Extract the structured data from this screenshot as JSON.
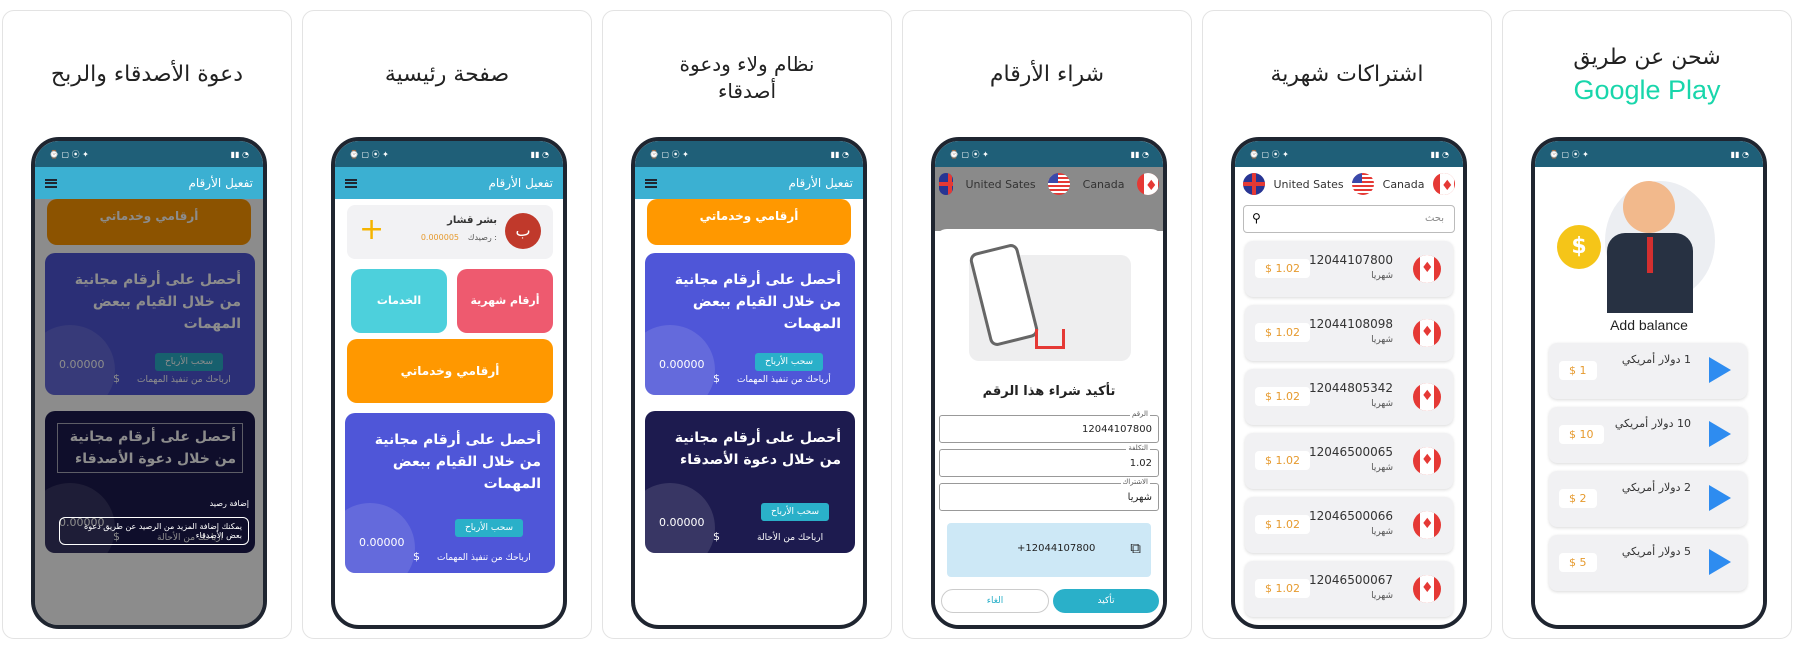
{
  "captions": {
    "p1": "شحن عن طريق",
    "p1_brand": "Google Play",
    "p2": "اشتراكات شهرية",
    "p3": "شراء الأرقام",
    "p4": "نظام ولاء ودعوة أصدقاء",
    "p5": "صفحة رئيسية",
    "p6": "دعوة الأصدقاء والربح"
  },
  "colors": {
    "brand_teal": "#19d6ab",
    "appbar": "#3bb0d2",
    "status": "#1f5f78",
    "orange": "#ff9800",
    "purple": "#4f56d8",
    "navy": "#1d1b4f"
  },
  "appbar_title": "تفعيل الأرقام",
  "recharge": {
    "heading": "Add balance",
    "items": [
      {
        "label": "1 دولار أمريكي",
        "price": "$ 1"
      },
      {
        "label": "10 دولار أمريكي",
        "price": "$ 10"
      },
      {
        "label": "2 دولار أمريكي",
        "price": "$ 2"
      },
      {
        "label": "5 دولار أمريكي",
        "price": "$ 5"
      }
    ]
  },
  "subscriptions": {
    "countries": [
      "United Sates",
      "Canada"
    ],
    "search_placeholder": "بحث",
    "rows": [
      {
        "number": "12044107800",
        "period": "شهريا",
        "price": "$ 1.02"
      },
      {
        "number": "12044108098",
        "period": "شهريا",
        "price": "$ 1.02"
      },
      {
        "number": "12044805342",
        "period": "شهريا",
        "price": "$ 1.02"
      },
      {
        "number": "12046500065",
        "period": "شهريا",
        "price": "$ 1.02"
      },
      {
        "number": "12046500066",
        "period": "شهريا",
        "price": "$ 1.02"
      },
      {
        "number": "12046500067",
        "period": "شهريا",
        "price": "$ 1.02"
      }
    ]
  },
  "purchase": {
    "countries": [
      "United Sates",
      "Canada"
    ],
    "confirm_title": "تأكيد شراء هذا الرقم",
    "field_number_label": "الرقم",
    "field_number_value": "12044107800",
    "field_cost_label": "التكلفة",
    "field_cost_value": "1.02",
    "field_sub_label": "الاشتراك",
    "field_sub_value": "شهريا",
    "copy_value": "+12044107800",
    "cancel": "الغاء",
    "confirm": "تأكيد"
  },
  "loyalty": {
    "orange_tile": "أرقامي وخدماتي",
    "tasks_title": "أحصل على أرقام مجانية من خلال القيام ببعض المهمات",
    "withdraw": "سحب الأرباح",
    "tasks_earnings": "أرباحك من تنفيذ المهمات",
    "amount": "0.00000",
    "currency": "$",
    "invite_title": "أحصل على أرقام مجانية من خلال دعوة الأصدقاء",
    "invite_earnings": "ارباحك من الأحالة"
  },
  "home": {
    "user_name": "بشر قشار",
    "balance_label": "رصيدك :",
    "balance_value": "0.000005",
    "avatar_letter": "ب",
    "monthly_numbers": "أرقام شهرية",
    "services": "الخدمات",
    "my_numbers": "أرقامي وخدماتي",
    "tasks_title": "أحصل على أرقام مجانية من خلال القيام ببعض المهمات",
    "withdraw": "سحب الأرباح",
    "amount": "0.00000",
    "currency": "$",
    "tasks_earnings": "ارباحك من تنفيذ المهمات"
  },
  "invite": {
    "orange_tile": "أرقامي وخدماتي",
    "tasks_title": "أحصل على أرقام مجانية من خلال القيام ببعض المهمات",
    "withdraw": "سحب الأرباح",
    "amount": "0.00000",
    "currency": "$",
    "tasks_earnings": "ارباحك من تنفيذ المهمات",
    "invite_title": "أحصل على أرقام مجانية من خلال دعوة الأصدقاء",
    "add_balance": "إضافة رصيد",
    "tooltip": "يمكنك إضافة المزيد من الرصيد عن طريق دعوة بعض الأصدقاء",
    "invite_earnings": "ارباحك من الأحالة"
  }
}
